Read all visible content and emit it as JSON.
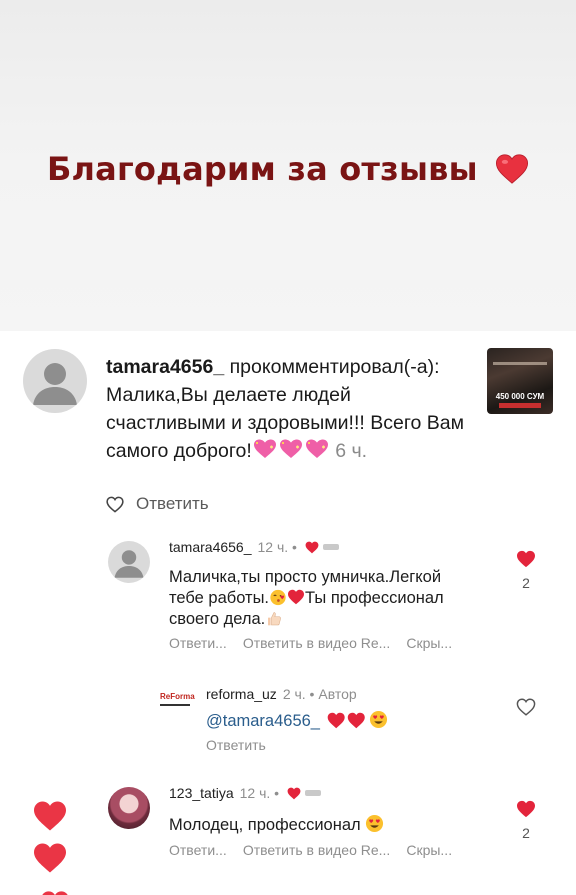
{
  "headline": {
    "text": "Благодарим за отзывы",
    "emoji": "heart-icon",
    "color": "#7a1414"
  },
  "notification": {
    "username": "tamara4656_",
    "action": " прокомментировал(-а):",
    "comment": " Малика,Вы делаете людей счастливыми и здоровыми!!! Всего Вам самого доброго!",
    "emojis": "sparkling-heart-icon x3",
    "age": " 6 ч.",
    "reply_label": "Ответить",
    "thumbnail": {
      "price": "450 000 СУМ"
    }
  },
  "comments": [
    {
      "username": "tamara4656_",
      "time": "12 ч. •",
      "text_1": "Маличка,ты просто умничка.Легкой тебе работы.",
      "text_2": "Ты профессионал своего дела.",
      "actions": [
        "Ответи...",
        "Ответить в видео Re...",
        "Скры..."
      ],
      "likes": "2"
    },
    {
      "username": "reforma_uz",
      "time": "2 ч. • Автор",
      "mention": "@tamara4656_",
      "reply_label": "Ответить",
      "logo_text": "ReForma"
    },
    {
      "username": "123_tatiya",
      "time": "12 ч. •",
      "text": "Молодец, профессионал",
      "actions": [
        "Ответи...",
        "Ответить в видео Re...",
        "Скры..."
      ],
      "likes": "2"
    }
  ],
  "colors": {
    "heart": "#e3243b",
    "headline": "#7a1414",
    "mention": "#2a5d8c"
  }
}
